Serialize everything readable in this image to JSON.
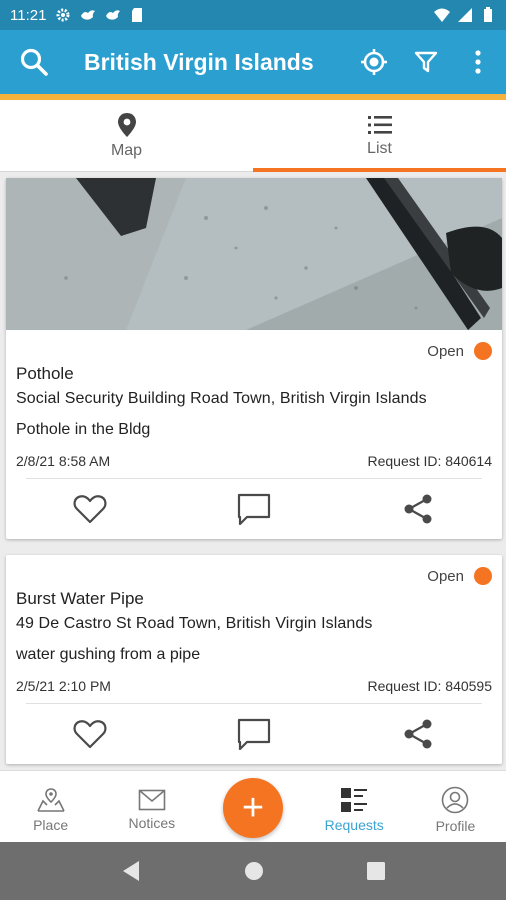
{
  "status_bar": {
    "time": "11:21"
  },
  "app_bar": {
    "title": "British Virgin Islands"
  },
  "tabs": [
    {
      "label": "Map",
      "icon": "map-pin-icon",
      "active": false
    },
    {
      "label": "List",
      "icon": "list-icon",
      "active": true
    }
  ],
  "requests": [
    {
      "status": "Open",
      "title": "Pothole",
      "address": "Social Security Building Road Town, British Virgin Islands",
      "description": "Pothole in the Bldg",
      "date": "2/8/21 8:58 AM",
      "request_id": "Request ID: 840614"
    },
    {
      "status": "Open",
      "title": "Burst Water Pipe",
      "address": "49 De Castro St Road Town, British Virgin Islands",
      "description": "water gushing from a pipe",
      "date": "2/5/21 2:10 PM",
      "request_id": "Request ID: 840595"
    }
  ],
  "bottom_nav": {
    "items": [
      {
        "label": "Place",
        "icon": "place-icon"
      },
      {
        "label": "Notices",
        "icon": "mail-icon"
      },
      {
        "label": "Requests",
        "icon": "requests-icon",
        "active": true
      },
      {
        "label": "Profile",
        "icon": "profile-icon"
      }
    ],
    "fab_label": "+"
  },
  "colors": {
    "primary": "#2a9fd0",
    "status_bar": "#2387b0",
    "accent": "#f47421",
    "accent_strip": "#f5b23c",
    "active_nav": "#3aa3d4"
  }
}
